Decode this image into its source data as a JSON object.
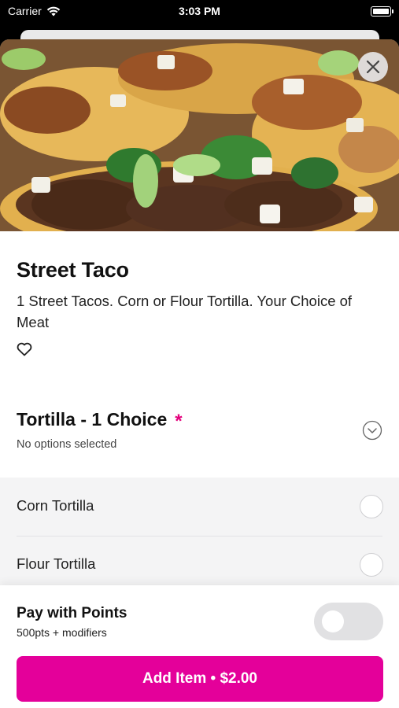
{
  "status_bar": {
    "carrier": "Carrier",
    "time": "3:03 PM"
  },
  "item": {
    "title": "Street Taco",
    "description": "1 Street Tacos. Corn or Flour Tortilla. Your Choice of Meat",
    "favorite_icon": "heart-outline-icon"
  },
  "modifier_group": {
    "title": "Tortilla - 1 Choice",
    "required_marker": "*",
    "status": "No options selected",
    "toggle_icon": "chevron-down-circle-icon",
    "options": [
      {
        "label": "Corn Tortilla",
        "selected": false
      },
      {
        "label": "Flour Tortilla",
        "selected": false
      }
    ]
  },
  "points": {
    "title": "Pay with Points",
    "subtitle": "500pts + modifiers",
    "enabled": false
  },
  "add_button": {
    "label": "Add Item • $2.00"
  },
  "colors": {
    "accent": "#e4009a",
    "required": "#e4007c"
  }
}
